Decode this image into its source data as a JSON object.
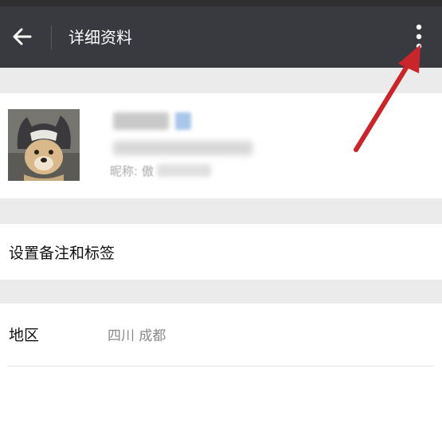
{
  "header": {
    "title": "详细资料",
    "back_icon": "arrow-left-icon",
    "more_icon": "more-vertical-icon",
    "background": "#393a3f"
  },
  "profile": {
    "nickname_prefix": "昵称: 傲"
  },
  "rows": {
    "remark_label": "设置备注和标签",
    "region_label": "地区",
    "region_value": "四川  成都"
  },
  "colors": {
    "page_gap": "#ebebeb",
    "annotation_arrow": "#c9262c"
  }
}
